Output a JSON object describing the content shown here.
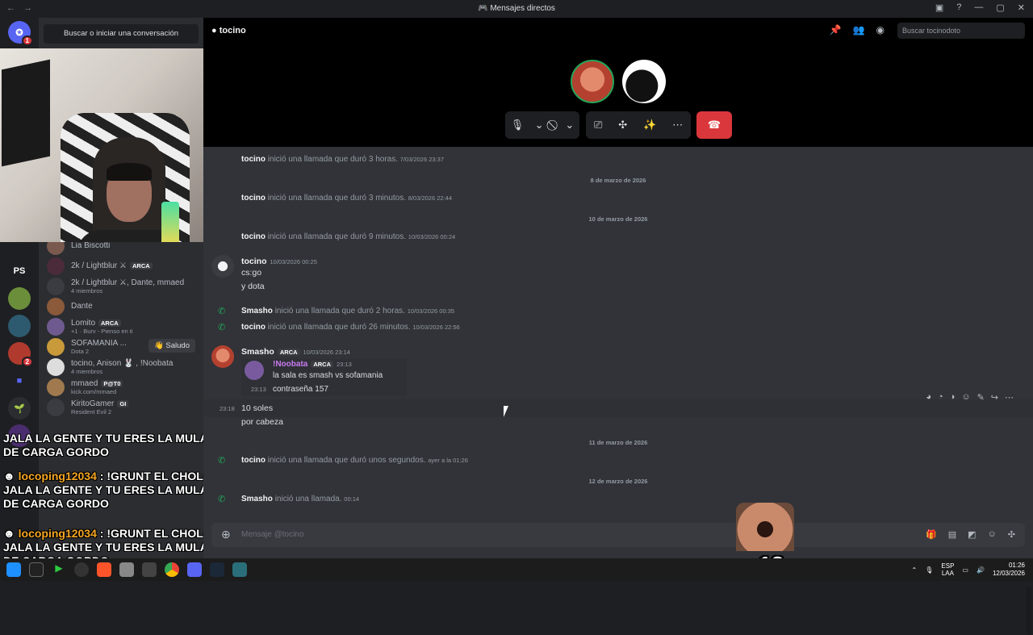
{
  "window": {
    "title": "Mensajes directos"
  },
  "dm_panel": {
    "search_label": "Buscar o iniciar una conversación"
  },
  "header": {
    "username": "tocino",
    "search_placeholder": "Buscar tocinodoto"
  },
  "guilds": [
    {
      "label": "",
      "badge": "1",
      "color": "#5865f2"
    },
    {
      "label": "PS",
      "badge": "",
      "color": "#1e1f22"
    },
    {
      "label": "",
      "badge": "2",
      "color": "#3b8d3b"
    }
  ],
  "dms": [
    {
      "name": "Lia Biscotti",
      "sub": "",
      "tag": ""
    },
    {
      "name": "2k / Lightblur ⚔",
      "sub": "",
      "tag": "ARCA"
    },
    {
      "name": "2k / Lightblur ⚔, Dante, mmaed",
      "sub": "4 miembros",
      "tag": ""
    },
    {
      "name": "Dante",
      "sub": "",
      "tag": ""
    },
    {
      "name": "Lomito",
      "sub": "+1 · Burv - Pienso en ti",
      "tag": "ARCA"
    },
    {
      "name": "SOFAMANIA ...",
      "sub": "Dota 2",
      "tag": ""
    },
    {
      "name": "tocino, Anison 🐰 , !Noobata",
      "sub": "4 miembros",
      "tag": ""
    },
    {
      "name": "mmaed",
      "sub": "kick.com/mmaed",
      "tag": "P@T0"
    },
    {
      "name": "KiritoGamer",
      "sub": "Resident Evil 2",
      "tag": "GI"
    }
  ],
  "saludo_label": "Saludo",
  "stream_overlay": {
    "lines": [
      {
        "user": "",
        "text": "JALA LA GENTE Y TU ERES LA MULA DE CARGA GORDO"
      },
      {
        "user": "locoping12034",
        "text": ": !GRUNT EL CHOLO JALA LA GENTE Y TU ERES LA MULA DE CARGA GORDO"
      },
      {
        "user": "locoping12034",
        "text": ": !GRUNT EL CHOLO JALA LA GENTE Y TU ERES LA MULA DE CARGA GORDO"
      }
    ],
    "emote_count": "x13"
  },
  "messages": {
    "sys1": {
      "author": "tocino",
      "text": "inició una llamada que duró 3 horas.",
      "ts": "7/03/2026 23:37"
    },
    "date1": "8 de marzo de 2026",
    "sys2": {
      "author": "tocino",
      "text": "inició una llamada que duró 3 minutos.",
      "ts": "8/03/2026 22:44"
    },
    "date2": "10 de marzo de 2026",
    "sys3": {
      "author": "tocino",
      "text": "inició una llamada que duró 9 minutos.",
      "ts": "10/03/2026 00:24"
    },
    "msg1": {
      "author": "tocino",
      "ts": "10/03/2026 00:25",
      "lines": [
        "cs:go",
        "y dota"
      ]
    },
    "sys4": {
      "author": "Smasho",
      "text": "inició una llamada que duró 2 horas.",
      "ts": "10/03/2026 00:35"
    },
    "sys5": {
      "author": "tocino",
      "text": "inició una llamada que duró 26 minutos.",
      "ts": "10/03/2026 22:56"
    },
    "msg2": {
      "author": "Smasho",
      "tag": "ARCA",
      "ts": "10/03/2026 23:14"
    },
    "reply": {
      "author": "!Noobata",
      "tag": "ARCA",
      "ts": "23:13",
      "text": "la sala es smash vs sofamania",
      "ts2": "23:13",
      "text2": "contraseña 157"
    },
    "msg3": {
      "ts": "23:18",
      "lines": [
        "10 soles",
        "por cabeza"
      ]
    },
    "date3": "11 de marzo de 2026",
    "sys6": {
      "author": "tocino",
      "text": "inició una llamada que duró unos segundos.",
      "ts": "ayer a la 01:26"
    },
    "date4": "12 de marzo de 2026",
    "sys7": {
      "author": "Smasho",
      "text": "inició una llamada.",
      "ts": "00:14"
    }
  },
  "composer": {
    "placeholder": "Mensaje @tocino"
  },
  "taskbar": {
    "lang": "ESP",
    "lang2": "LAA",
    "time": "01:26",
    "date": "12/03/2026"
  }
}
